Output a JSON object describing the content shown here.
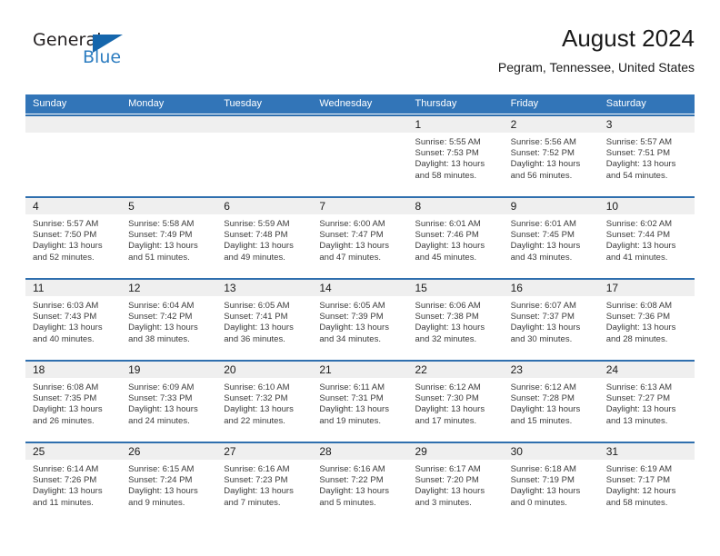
{
  "brand": {
    "name_part1": "General",
    "name_part2": "Blue",
    "logo_icon": "triangle-flag-icon"
  },
  "header": {
    "title": "August 2024",
    "location": "Pegram, Tennessee, United States"
  },
  "calendar": {
    "weekday_headers": [
      "Sunday",
      "Monday",
      "Tuesday",
      "Wednesday",
      "Thursday",
      "Friday",
      "Saturday"
    ],
    "accent_color": "#3275b8",
    "daynum_bg": "#efefef",
    "weeks": [
      {
        "days": [
          {
            "num": "",
            "sunrise": "",
            "sunset": "",
            "daylight_line1": "",
            "daylight_line2": ""
          },
          {
            "num": "",
            "sunrise": "",
            "sunset": "",
            "daylight_line1": "",
            "daylight_line2": ""
          },
          {
            "num": "",
            "sunrise": "",
            "sunset": "",
            "daylight_line1": "",
            "daylight_line2": ""
          },
          {
            "num": "",
            "sunrise": "",
            "sunset": "",
            "daylight_line1": "",
            "daylight_line2": ""
          },
          {
            "num": "1",
            "sunrise": "Sunrise: 5:55 AM",
            "sunset": "Sunset: 7:53 PM",
            "daylight_line1": "Daylight: 13 hours",
            "daylight_line2": "and 58 minutes."
          },
          {
            "num": "2",
            "sunrise": "Sunrise: 5:56 AM",
            "sunset": "Sunset: 7:52 PM",
            "daylight_line1": "Daylight: 13 hours",
            "daylight_line2": "and 56 minutes."
          },
          {
            "num": "3",
            "sunrise": "Sunrise: 5:57 AM",
            "sunset": "Sunset: 7:51 PM",
            "daylight_line1": "Daylight: 13 hours",
            "daylight_line2": "and 54 minutes."
          }
        ]
      },
      {
        "days": [
          {
            "num": "4",
            "sunrise": "Sunrise: 5:57 AM",
            "sunset": "Sunset: 7:50 PM",
            "daylight_line1": "Daylight: 13 hours",
            "daylight_line2": "and 52 minutes."
          },
          {
            "num": "5",
            "sunrise": "Sunrise: 5:58 AM",
            "sunset": "Sunset: 7:49 PM",
            "daylight_line1": "Daylight: 13 hours",
            "daylight_line2": "and 51 minutes."
          },
          {
            "num": "6",
            "sunrise": "Sunrise: 5:59 AM",
            "sunset": "Sunset: 7:48 PM",
            "daylight_line1": "Daylight: 13 hours",
            "daylight_line2": "and 49 minutes."
          },
          {
            "num": "7",
            "sunrise": "Sunrise: 6:00 AM",
            "sunset": "Sunset: 7:47 PM",
            "daylight_line1": "Daylight: 13 hours",
            "daylight_line2": "and 47 minutes."
          },
          {
            "num": "8",
            "sunrise": "Sunrise: 6:01 AM",
            "sunset": "Sunset: 7:46 PM",
            "daylight_line1": "Daylight: 13 hours",
            "daylight_line2": "and 45 minutes."
          },
          {
            "num": "9",
            "sunrise": "Sunrise: 6:01 AM",
            "sunset": "Sunset: 7:45 PM",
            "daylight_line1": "Daylight: 13 hours",
            "daylight_line2": "and 43 minutes."
          },
          {
            "num": "10",
            "sunrise": "Sunrise: 6:02 AM",
            "sunset": "Sunset: 7:44 PM",
            "daylight_line1": "Daylight: 13 hours",
            "daylight_line2": "and 41 minutes."
          }
        ]
      },
      {
        "days": [
          {
            "num": "11",
            "sunrise": "Sunrise: 6:03 AM",
            "sunset": "Sunset: 7:43 PM",
            "daylight_line1": "Daylight: 13 hours",
            "daylight_line2": "and 40 minutes."
          },
          {
            "num": "12",
            "sunrise": "Sunrise: 6:04 AM",
            "sunset": "Sunset: 7:42 PM",
            "daylight_line1": "Daylight: 13 hours",
            "daylight_line2": "and 38 minutes."
          },
          {
            "num": "13",
            "sunrise": "Sunrise: 6:05 AM",
            "sunset": "Sunset: 7:41 PM",
            "daylight_line1": "Daylight: 13 hours",
            "daylight_line2": "and 36 minutes."
          },
          {
            "num": "14",
            "sunrise": "Sunrise: 6:05 AM",
            "sunset": "Sunset: 7:39 PM",
            "daylight_line1": "Daylight: 13 hours",
            "daylight_line2": "and 34 minutes."
          },
          {
            "num": "15",
            "sunrise": "Sunrise: 6:06 AM",
            "sunset": "Sunset: 7:38 PM",
            "daylight_line1": "Daylight: 13 hours",
            "daylight_line2": "and 32 minutes."
          },
          {
            "num": "16",
            "sunrise": "Sunrise: 6:07 AM",
            "sunset": "Sunset: 7:37 PM",
            "daylight_line1": "Daylight: 13 hours",
            "daylight_line2": "and 30 minutes."
          },
          {
            "num": "17",
            "sunrise": "Sunrise: 6:08 AM",
            "sunset": "Sunset: 7:36 PM",
            "daylight_line1": "Daylight: 13 hours",
            "daylight_line2": "and 28 minutes."
          }
        ]
      },
      {
        "days": [
          {
            "num": "18",
            "sunrise": "Sunrise: 6:08 AM",
            "sunset": "Sunset: 7:35 PM",
            "daylight_line1": "Daylight: 13 hours",
            "daylight_line2": "and 26 minutes."
          },
          {
            "num": "19",
            "sunrise": "Sunrise: 6:09 AM",
            "sunset": "Sunset: 7:33 PM",
            "daylight_line1": "Daylight: 13 hours",
            "daylight_line2": "and 24 minutes."
          },
          {
            "num": "20",
            "sunrise": "Sunrise: 6:10 AM",
            "sunset": "Sunset: 7:32 PM",
            "daylight_line1": "Daylight: 13 hours",
            "daylight_line2": "and 22 minutes."
          },
          {
            "num": "21",
            "sunrise": "Sunrise: 6:11 AM",
            "sunset": "Sunset: 7:31 PM",
            "daylight_line1": "Daylight: 13 hours",
            "daylight_line2": "and 19 minutes."
          },
          {
            "num": "22",
            "sunrise": "Sunrise: 6:12 AM",
            "sunset": "Sunset: 7:30 PM",
            "daylight_line1": "Daylight: 13 hours",
            "daylight_line2": "and 17 minutes."
          },
          {
            "num": "23",
            "sunrise": "Sunrise: 6:12 AM",
            "sunset": "Sunset: 7:28 PM",
            "daylight_line1": "Daylight: 13 hours",
            "daylight_line2": "and 15 minutes."
          },
          {
            "num": "24",
            "sunrise": "Sunrise: 6:13 AM",
            "sunset": "Sunset: 7:27 PM",
            "daylight_line1": "Daylight: 13 hours",
            "daylight_line2": "and 13 minutes."
          }
        ]
      },
      {
        "days": [
          {
            "num": "25",
            "sunrise": "Sunrise: 6:14 AM",
            "sunset": "Sunset: 7:26 PM",
            "daylight_line1": "Daylight: 13 hours",
            "daylight_line2": "and 11 minutes."
          },
          {
            "num": "26",
            "sunrise": "Sunrise: 6:15 AM",
            "sunset": "Sunset: 7:24 PM",
            "daylight_line1": "Daylight: 13 hours",
            "daylight_line2": "and 9 minutes."
          },
          {
            "num": "27",
            "sunrise": "Sunrise: 6:16 AM",
            "sunset": "Sunset: 7:23 PM",
            "daylight_line1": "Daylight: 13 hours",
            "daylight_line2": "and 7 minutes."
          },
          {
            "num": "28",
            "sunrise": "Sunrise: 6:16 AM",
            "sunset": "Sunset: 7:22 PM",
            "daylight_line1": "Daylight: 13 hours",
            "daylight_line2": "and 5 minutes."
          },
          {
            "num": "29",
            "sunrise": "Sunrise: 6:17 AM",
            "sunset": "Sunset: 7:20 PM",
            "daylight_line1": "Daylight: 13 hours",
            "daylight_line2": "and 3 minutes."
          },
          {
            "num": "30",
            "sunrise": "Sunrise: 6:18 AM",
            "sunset": "Sunset: 7:19 PM",
            "daylight_line1": "Daylight: 13 hours",
            "daylight_line2": "and 0 minutes."
          },
          {
            "num": "31",
            "sunrise": "Sunrise: 6:19 AM",
            "sunset": "Sunset: 7:17 PM",
            "daylight_line1": "Daylight: 12 hours",
            "daylight_line2": "and 58 minutes."
          }
        ]
      }
    ]
  }
}
